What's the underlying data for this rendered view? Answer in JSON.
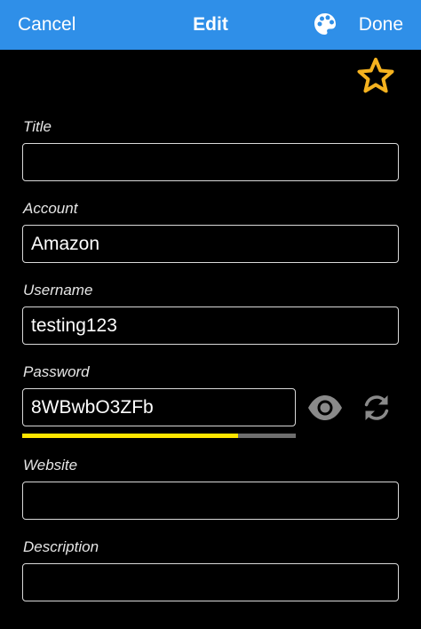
{
  "navbar": {
    "cancel_label": "Cancel",
    "title": "Edit",
    "done_label": "Done",
    "palette_icon": "palette-icon",
    "background_color": "#2f8fe8"
  },
  "favorite": {
    "icon": "star-icon",
    "color": "#f5b21f"
  },
  "fields": {
    "title": {
      "label": "Title",
      "value": ""
    },
    "account": {
      "label": "Account",
      "value": "Amazon"
    },
    "username": {
      "label": "Username",
      "value": "testing123"
    },
    "password": {
      "label": "Password",
      "value": "8WBwbO3ZFb",
      "strength": 0.79,
      "strength_color": "#ffe600",
      "reveal_icon": "eye-icon",
      "generate_icon": "refresh-icon"
    },
    "website": {
      "label": "Website",
      "value": ""
    },
    "description": {
      "label": "Description",
      "value": ""
    }
  }
}
